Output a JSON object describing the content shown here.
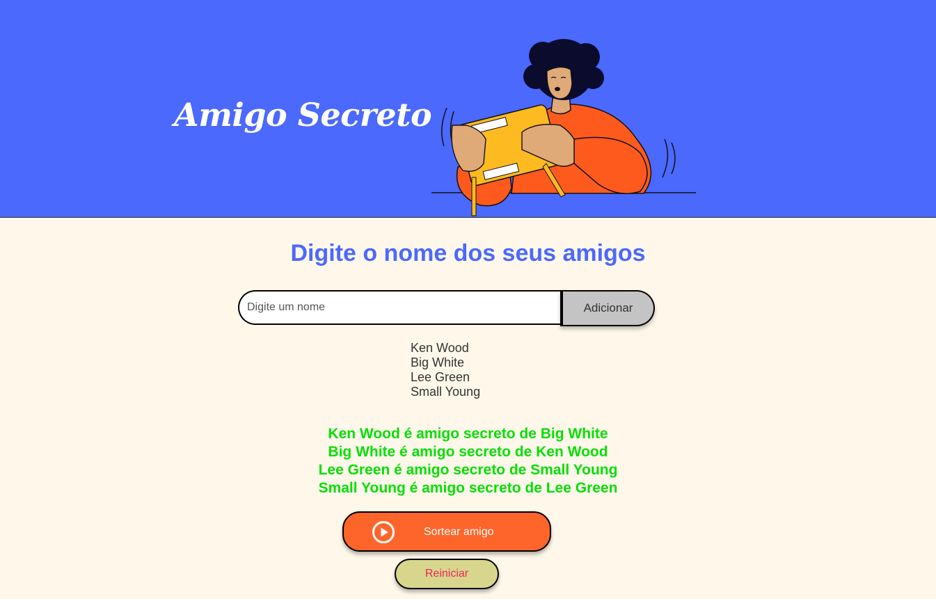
{
  "header": {
    "title": "Amigo Secreto",
    "background_color": "#4B69FD",
    "illustration": "person-opening-gift-illustration"
  },
  "main": {
    "subtitle": "Digite o nome dos seus amigos",
    "input": {
      "placeholder": "Digite um nome",
      "value": ""
    },
    "add_button_label": "Adicionar",
    "friends": [
      "Ken Wood",
      "Big White",
      "Lee Green",
      "Small Young"
    ],
    "results": [
      "Ken Wood é amigo secreto de Big White",
      "Big White é amigo secreto de Ken Wood",
      "Lee Green é amigo secreto de Small Young",
      "Small Young é amigo secreto de Lee Green"
    ],
    "draw_button": {
      "label": "Sortear amigo",
      "icon": "play-circle-icon",
      "color": "#FE652B"
    },
    "reset_button": {
      "label": "Reiniciar",
      "color": "#D7D68C",
      "text_color": "#F0245D"
    },
    "result_color": "#05DF05",
    "page_background": "#FFF8EA"
  }
}
